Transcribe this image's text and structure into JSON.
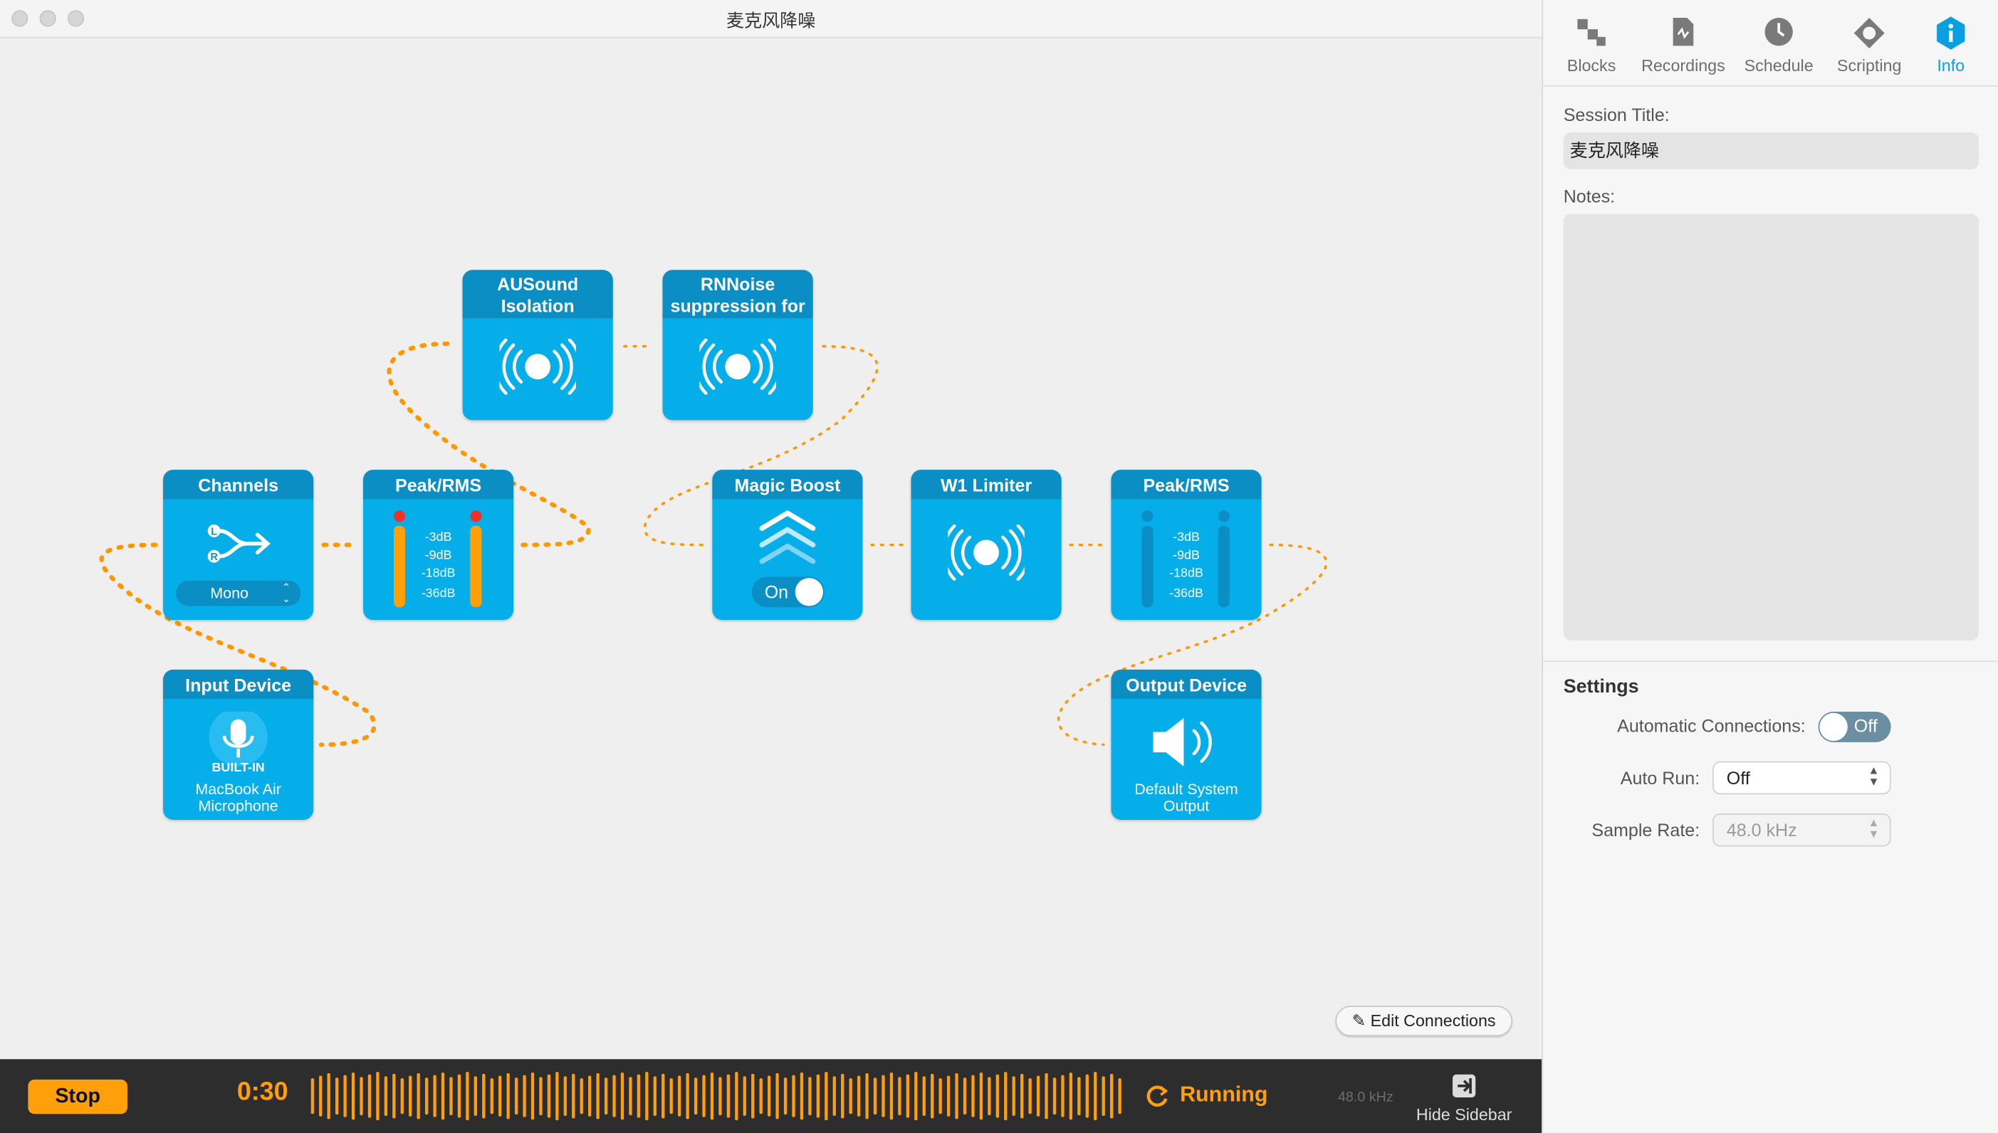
{
  "window": {
    "title": "麦克风降噪"
  },
  "blocks": {
    "channels": {
      "title": "Channels",
      "mode": "Mono"
    },
    "peak1": {
      "title": "Peak/RMS",
      "labels": [
        "-3dB",
        "-9dB",
        "-18dB",
        "-36dB"
      ]
    },
    "input": {
      "title": "Input Device",
      "badge": "BUILT-IN",
      "line1": "MacBook Air",
      "line2": "Microphone"
    },
    "ausound": {
      "title1": "AUSound",
      "title2": "Isolation"
    },
    "rnnoise": {
      "title1": "RNNoise",
      "title2": "suppression for"
    },
    "magic": {
      "title": "Magic Boost",
      "toggle": "On"
    },
    "w1": {
      "title": "W1 Limiter"
    },
    "peak2": {
      "title": "Peak/RMS",
      "labels": [
        "-3dB",
        "-9dB",
        "-18dB",
        "-36dB"
      ]
    },
    "output": {
      "title": "Output Device",
      "line1": "Default System",
      "line2": "Output"
    }
  },
  "toolbar": {
    "edit_connections": "Edit Connections"
  },
  "bottombar": {
    "stop": "Stop",
    "time": "0:30",
    "status": "Running",
    "rate": "48.0 kHz",
    "hide_sidebar": "Hide Sidebar"
  },
  "sidebar": {
    "tabs": [
      {
        "label": "Blocks",
        "icon": "blocks-icon"
      },
      {
        "label": "Recordings",
        "icon": "recordings-icon"
      },
      {
        "label": "Schedule",
        "icon": "clock-icon"
      },
      {
        "label": "Scripting",
        "icon": "scripting-icon"
      },
      {
        "label": "Info",
        "icon": "info-icon"
      }
    ],
    "session_title_label": "Session Title:",
    "session_title": "麦克风降噪",
    "notes_label": "Notes:",
    "settings_heading": "Settings",
    "auto_connections_label": "Automatic Connections:",
    "auto_connections": "Off",
    "auto_run_label": "Auto Run:",
    "auto_run": "Off",
    "sample_rate_label": "Sample Rate:",
    "sample_rate": "48.0 kHz"
  },
  "colors": {
    "accent": "#05aee8",
    "header": "#0a8ec3",
    "orange": "#ff9f0a",
    "info_active": "#0a9fe0"
  }
}
